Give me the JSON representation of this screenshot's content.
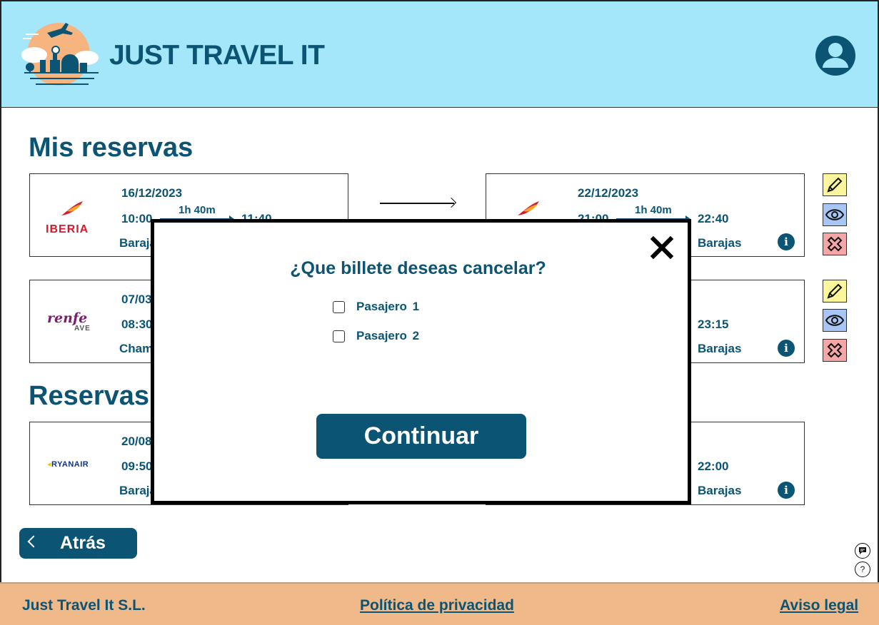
{
  "header": {
    "brand": "JUST TRAVEL IT",
    "logo_icon": "city-sunset-plane-logo",
    "user_icon": "user-account-icon"
  },
  "sections": {
    "mine_title": "Mis reservas",
    "other_title": "Reservas"
  },
  "bookings": [
    {
      "carrier": "IBERIA",
      "outbound": {
        "date": "16/12/2023",
        "dep": "10:00",
        "dur": "1h 40m",
        "arr": "11:40",
        "station": "Barajas"
      },
      "return": {
        "date": "22/12/2023",
        "dep": "21:00",
        "dur": "1h 40m",
        "arr": "22:40",
        "station": "Barajas"
      }
    },
    {
      "carrier": "renfe",
      "carrier_sub": "AVE",
      "outbound": {
        "date": "07/03",
        "dep": "08:30",
        "station": "Cham"
      },
      "return": {
        "arr": "23:15",
        "station": "Barajas"
      }
    },
    {
      "carrier": "RYANAIR",
      "outbound": {
        "date": "20/08",
        "dep": "09:50",
        "station": "Baraja"
      },
      "return": {
        "arr": "22:00",
        "station": "Barajas"
      }
    }
  ],
  "modal": {
    "question": "¿Que billete deseas cancelar?",
    "options": [
      "Pasajero  1",
      "Pasajero  2"
    ],
    "continue_label": "Continuar"
  },
  "back_label": "Atrás",
  "footer": {
    "company": "Just Travel It S.L.",
    "privacy": "Política de privacidad",
    "legal": "Aviso legal"
  },
  "colors": {
    "primary": "#0b5473",
    "header_bg": "#a4e7fb",
    "footer_bg": "#f0b98a",
    "edit_bg": "#fbf69c",
    "view_bg": "#a8c6f5",
    "delete_bg": "#f6a6a6"
  }
}
